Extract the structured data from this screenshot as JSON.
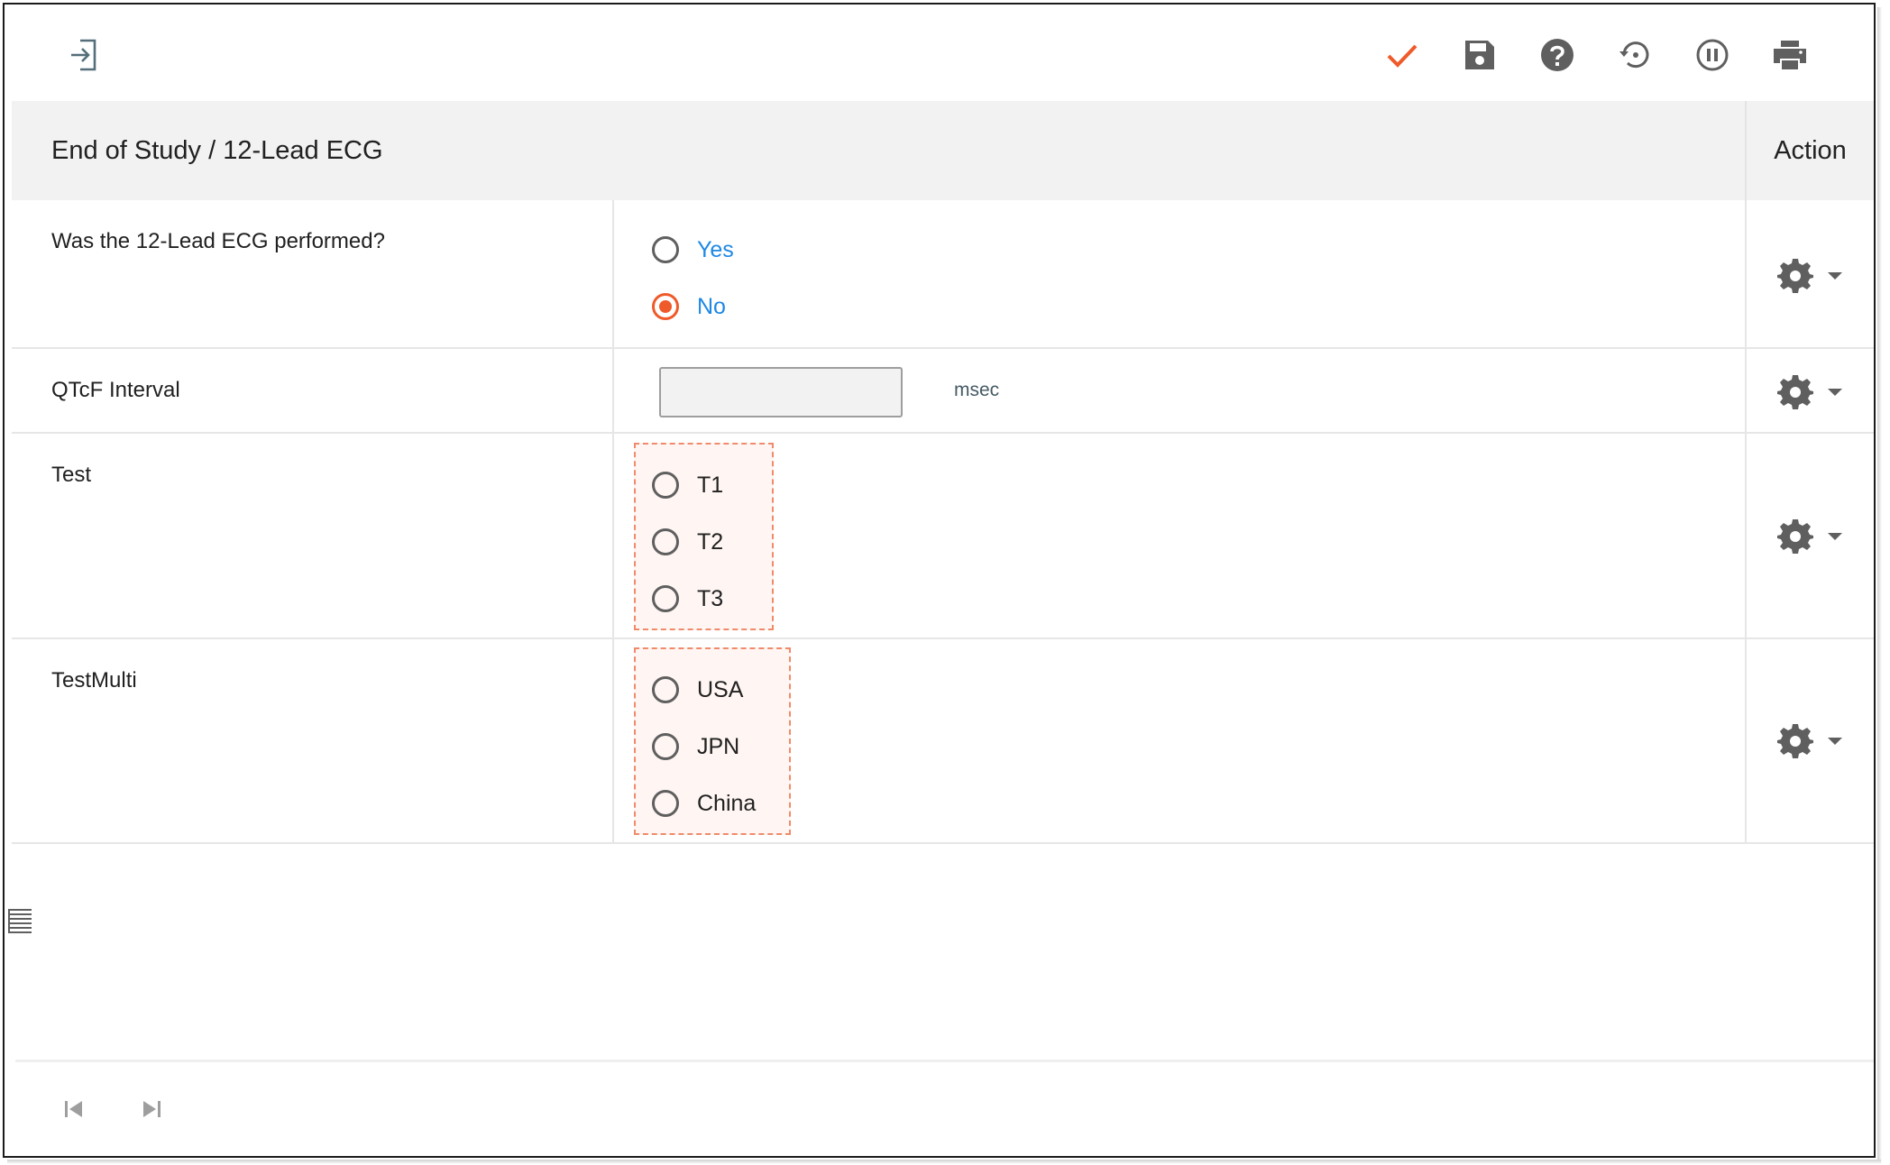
{
  "toolbar": {
    "buttons": [
      {
        "icon": "login-arrow-icon"
      },
      {
        "icon": "checkmark-icon",
        "color": "#ef5a2a"
      },
      {
        "icon": "save-disk-icon"
      },
      {
        "icon": "help-circle-icon"
      },
      {
        "icon": "history-restore-icon"
      },
      {
        "icon": "pause-circle-icon"
      },
      {
        "icon": "print-icon"
      }
    ]
  },
  "table": {
    "header_title": "End of Study / 12-Lead ECG",
    "header_action": "Action",
    "rows": [
      {
        "label": "Was the 12-Lead ECG performed?",
        "type": "radio",
        "options": [
          {
            "label": "Yes",
            "checked": false
          },
          {
            "label": "No",
            "checked": true
          }
        ]
      },
      {
        "label": "QTcF Interval",
        "type": "text",
        "value": "",
        "unit": "msec"
      },
      {
        "label": "Test",
        "type": "radio",
        "options": [
          {
            "label": "T1",
            "checked": false
          },
          {
            "label": "T2",
            "checked": false
          },
          {
            "label": "T3",
            "checked": false
          }
        ]
      },
      {
        "label": "TestMulti",
        "type": "radio",
        "options": [
          {
            "label": "USA",
            "checked": false
          },
          {
            "label": "JPN",
            "checked": false
          },
          {
            "label": "China",
            "checked": false
          }
        ]
      }
    ]
  },
  "colors": {
    "accent": "#ef5a2a",
    "option_link": "#1e88e5",
    "header_bg": "#f2f2f2",
    "icon": "#5f5f5f"
  },
  "footer": {
    "pager": [
      {
        "icon": "first-page-icon"
      },
      {
        "icon": "last-page-icon"
      }
    ]
  },
  "side": {
    "icon": "list-lines-icon"
  }
}
